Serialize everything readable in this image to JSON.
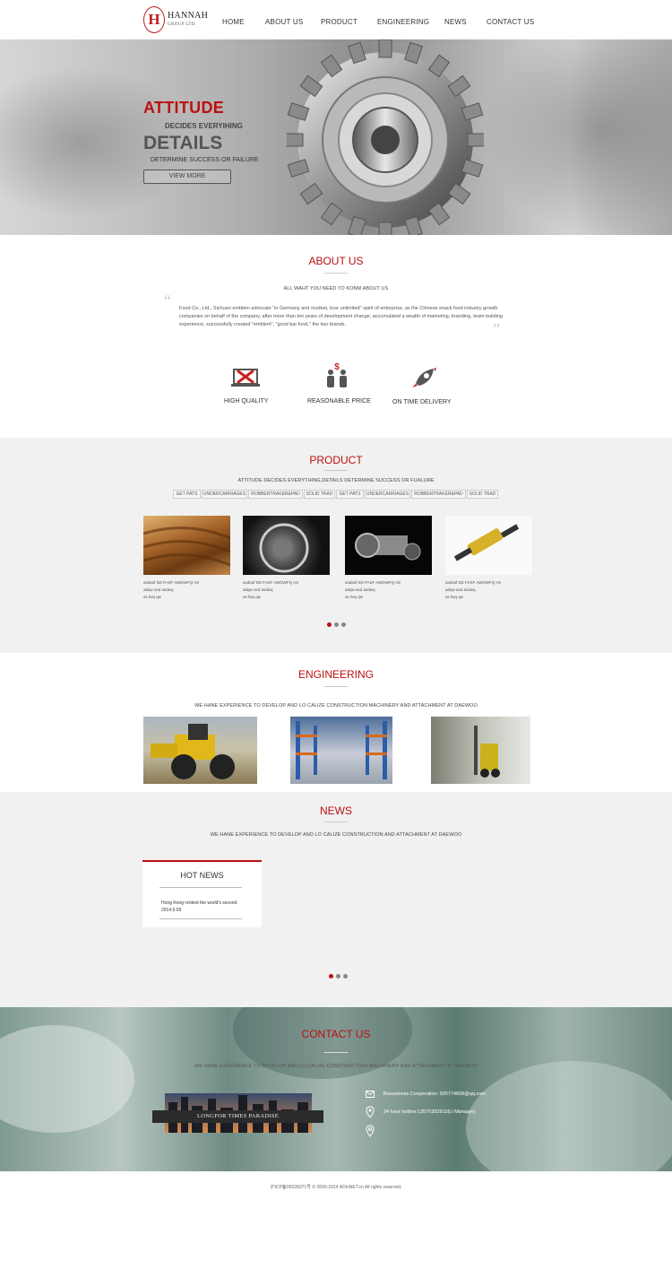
{
  "header": {
    "logo_letter": "H",
    "logo_name": "HANNAH",
    "logo_sub": "GROUP LTD",
    "nav": [
      "HOME",
      "ABOUT US",
      "PRODUCT",
      "ENGINEERING",
      "NEWS",
      "CONTACT US"
    ]
  },
  "hero": {
    "title1": "ATTITUDE",
    "sub1": "DECIDES EVERYIHING",
    "title2": "DETAILS",
    "sub2": "DETERMINE SUCCESS OR FAILURE",
    "button": "VIEW MORE"
  },
  "about": {
    "title": "ABOUT US",
    "subtitle": "ALL WAHT YOU NEED TO KONM ABOUT US",
    "text": "Food Co., Ltd., Sichuan emblem advocate \"in Germany and modest, love unlimited\" spirit of enterprise, as the Chinese snack food industry growth companies on behalf of the company, after more than ten years of development change, accumulated a wealth of marketing, branding, team building experience, successfully created \"emblem\", \"good bar food,\" the two brands.",
    "quote_open": "“",
    "quote_close": "”",
    "features": [
      {
        "label": "HIGH QUALITY",
        "icon": "tools-icon"
      },
      {
        "label": "REASONABLE PRICE",
        "icon": "price-people-icon"
      },
      {
        "label": "ON TIME DELIVERY",
        "icon": "rocket-icon"
      }
    ]
  },
  "product": {
    "title": "PRODUCT",
    "subtitle": "ATTITUDE DECIDES EVERYTHING,DETAILS DETERMINE SUCCESS OR FUALURE",
    "tabs": [
      "GET PATS",
      "UNDERCARRIAGES",
      "ROBBERTRAKER&PAD",
      "SOLID TRAD",
      "GET PATS",
      "UNDERCARRIAGES",
      "ROBBERTRAKER&PAD",
      "SOLID TRAD"
    ],
    "items": [
      {
        "line1": "asdsaf SD FASF AWDWFQ AS",
        "line2": "adqw asd asdwq",
        "line3": "as fwq qw"
      },
      {
        "line1": "asdsaf SD FASF AWDWFQ AS",
        "line2": "adqw asd asdwq",
        "line3": "as fwq qw"
      },
      {
        "line1": "asdsaf SD FASF AWDWFQ AS",
        "line2": "adqw asd asdwq",
        "line3": "as fwq qw"
      },
      {
        "line1": "asdsaf SD FASF AWDWFQ AS",
        "line2": "adqw asd asdwq",
        "line3": "as fwq qw"
      }
    ]
  },
  "engineering": {
    "title": "ENGINEERING",
    "subtitle": "WE HANE EXPERIENCE TO DEVELOP AND  LO CALIZE CONSTRUCTION MACHINERY AND ATTACHMENT AT DAEWOO"
  },
  "news": {
    "title": "NEWS",
    "subtitle": "WE HANE EXPERIENCE TO DEVELOP AND  LO CALIZE CONSTRUCTION AND ATTACHMENT AT DAEWOO",
    "hot_title": "HOT NEWS",
    "hot_item": "Hong Kong renked the world's second",
    "hot_date": "2014.5.09"
  },
  "contact": {
    "title": "CONTACT US",
    "subtitle": "WE HANE EXPERIENCE TO DEVELOP AND  LO CALIZE CONSTRUCTION MACHINERY AND ATTACHMENT AT DAEWOO",
    "city_caption": "LONGFOR TIMES PARADISE",
    "business": "Buessiness Cooperation:   925774658@qq.com",
    "hotline": "24 hour hotline:13570392915(Li Manager)"
  },
  "footer": {
    "text": "沪ICP备05026071号 © 2006-2014 ADinNET.cn All rights reserved."
  },
  "colors": {
    "accent": "#bb1111",
    "section_gray": "#f1f1f1"
  }
}
